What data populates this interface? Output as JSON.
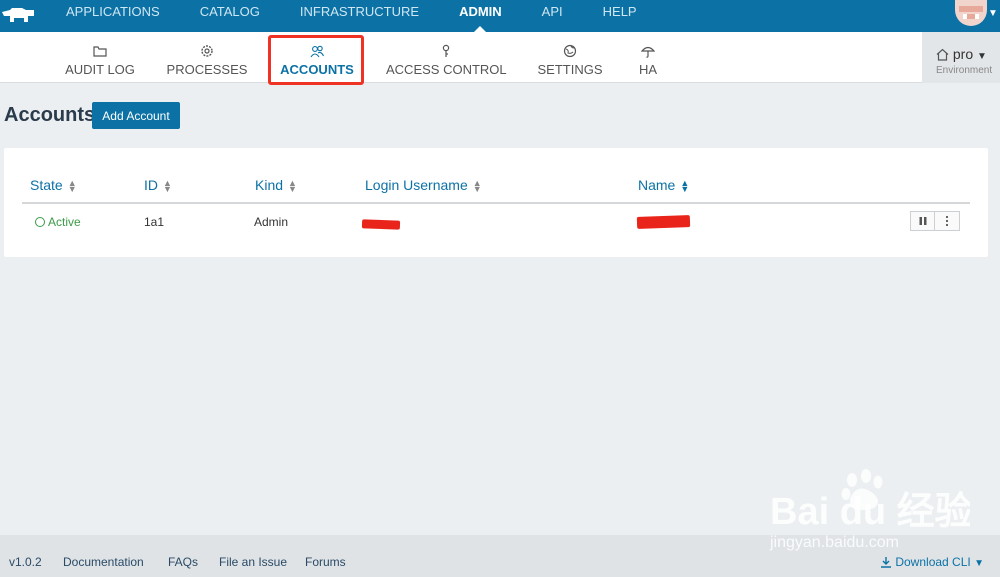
{
  "topnav": {
    "items": [
      {
        "label": "APPLICATIONS"
      },
      {
        "label": "CATALOG"
      },
      {
        "label": "INFRASTRUCTURE"
      },
      {
        "label": "ADMIN"
      },
      {
        "label": "API"
      },
      {
        "label": "HELP"
      }
    ],
    "active_index": 3
  },
  "subnav": {
    "items": [
      {
        "label": "AUDIT LOG",
        "icon": "folder-icon"
      },
      {
        "label": "PROCESSES",
        "icon": "gear-icon"
      },
      {
        "label": "ACCOUNTS",
        "icon": "users-icon"
      },
      {
        "label": "ACCESS CONTROL",
        "icon": "key-icon"
      },
      {
        "label": "SETTINGS",
        "icon": "globe-icon"
      },
      {
        "label": "HA",
        "icon": "umbrella-icon"
      }
    ],
    "active_index": 2
  },
  "environment": {
    "name": "pro",
    "label": "Environment"
  },
  "page": {
    "title": "Accounts",
    "add_button": "Add Account"
  },
  "table": {
    "columns": [
      "State",
      "ID",
      "Kind",
      "Login Username",
      "Name"
    ],
    "rows": [
      {
        "state": "Active",
        "id": "1a1",
        "kind": "Admin"
      }
    ]
  },
  "footer": {
    "version": "v1.0.2",
    "links": [
      "Documentation",
      "FAQs",
      "File an Issue",
      "Forums"
    ],
    "download": "Download CLI"
  },
  "watermark": {
    "text": "jingyan.baidu.com",
    "logo_text": "Bai du 经验"
  },
  "colors": {
    "primary": "#0c72a6",
    "active_green": "#3c9a48",
    "highlight_red": "#ee3224"
  }
}
